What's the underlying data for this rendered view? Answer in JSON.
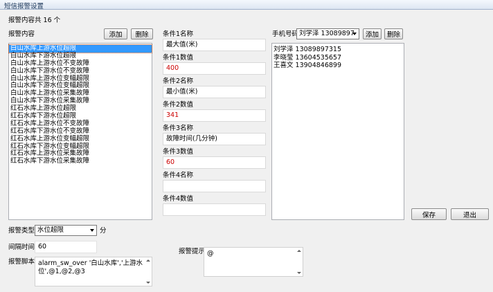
{
  "window": {
    "title": "短信报警设置"
  },
  "summary": {
    "label": "报警内容共",
    "count": "16",
    "unit": "个"
  },
  "alarm_content": {
    "label": "报警内容",
    "add_label": "添加",
    "delete_label": "删除",
    "items": [
      "白山水库上游水位超限",
      "白山水库下游水位超限",
      "白山水库上游水位不变故障",
      "白山水库下游水位不变故障",
      "白山水库上游水位变幅超限",
      "白山水库下游水位变幅超限",
      "白山水库上游水位采集故障",
      "白山水库下游水位采集故障",
      "红石水库上游水位超限",
      "红石水库下游水位超限",
      "红石水库上游水位不变故障",
      "红石水库下游水位不变故障",
      "红石水库上游水位变幅超限",
      "红石水库下游水位变幅超限",
      "红石水库上游水位采集故障",
      "红石水库下游水位采集故障"
    ],
    "selected_index": 0
  },
  "conditions": [
    {
      "name_label": "条件1名称",
      "name_value": "最大值(米)",
      "value_label": "条件1数值",
      "value_value": "400"
    },
    {
      "name_label": "条件2名称",
      "name_value": "最小值(米)",
      "value_label": "条件2数值",
      "value_value": "341"
    },
    {
      "name_label": "条件3名称",
      "name_value": "故障时间(几分钟)",
      "value_label": "条件3数值",
      "value_value": "60"
    },
    {
      "name_label": "条件4名称",
      "name_value": "",
      "value_label": "条件4数值",
      "value_value": ""
    }
  ],
  "phone": {
    "label": "手机号码",
    "selected": "刘学泽 13089897",
    "add_label": "添加",
    "delete_label": "删除",
    "list": [
      "刘学泽 13089897315",
      "李晓莹 13604535657",
      "王喜文 13904846899"
    ]
  },
  "actions": {
    "save_label": "保存",
    "exit_label": "退出"
  },
  "alarm_type": {
    "label": "报警类型",
    "selected": "水位超限",
    "unit": "分"
  },
  "interval": {
    "label": "间隔时间",
    "value": "60"
  },
  "script": {
    "label": "报警脚本",
    "value": "alarm_sw_over '白山水库','上游水位',@1,@2,@3"
  },
  "hint": {
    "label": "报警提示",
    "value": "@"
  }
}
